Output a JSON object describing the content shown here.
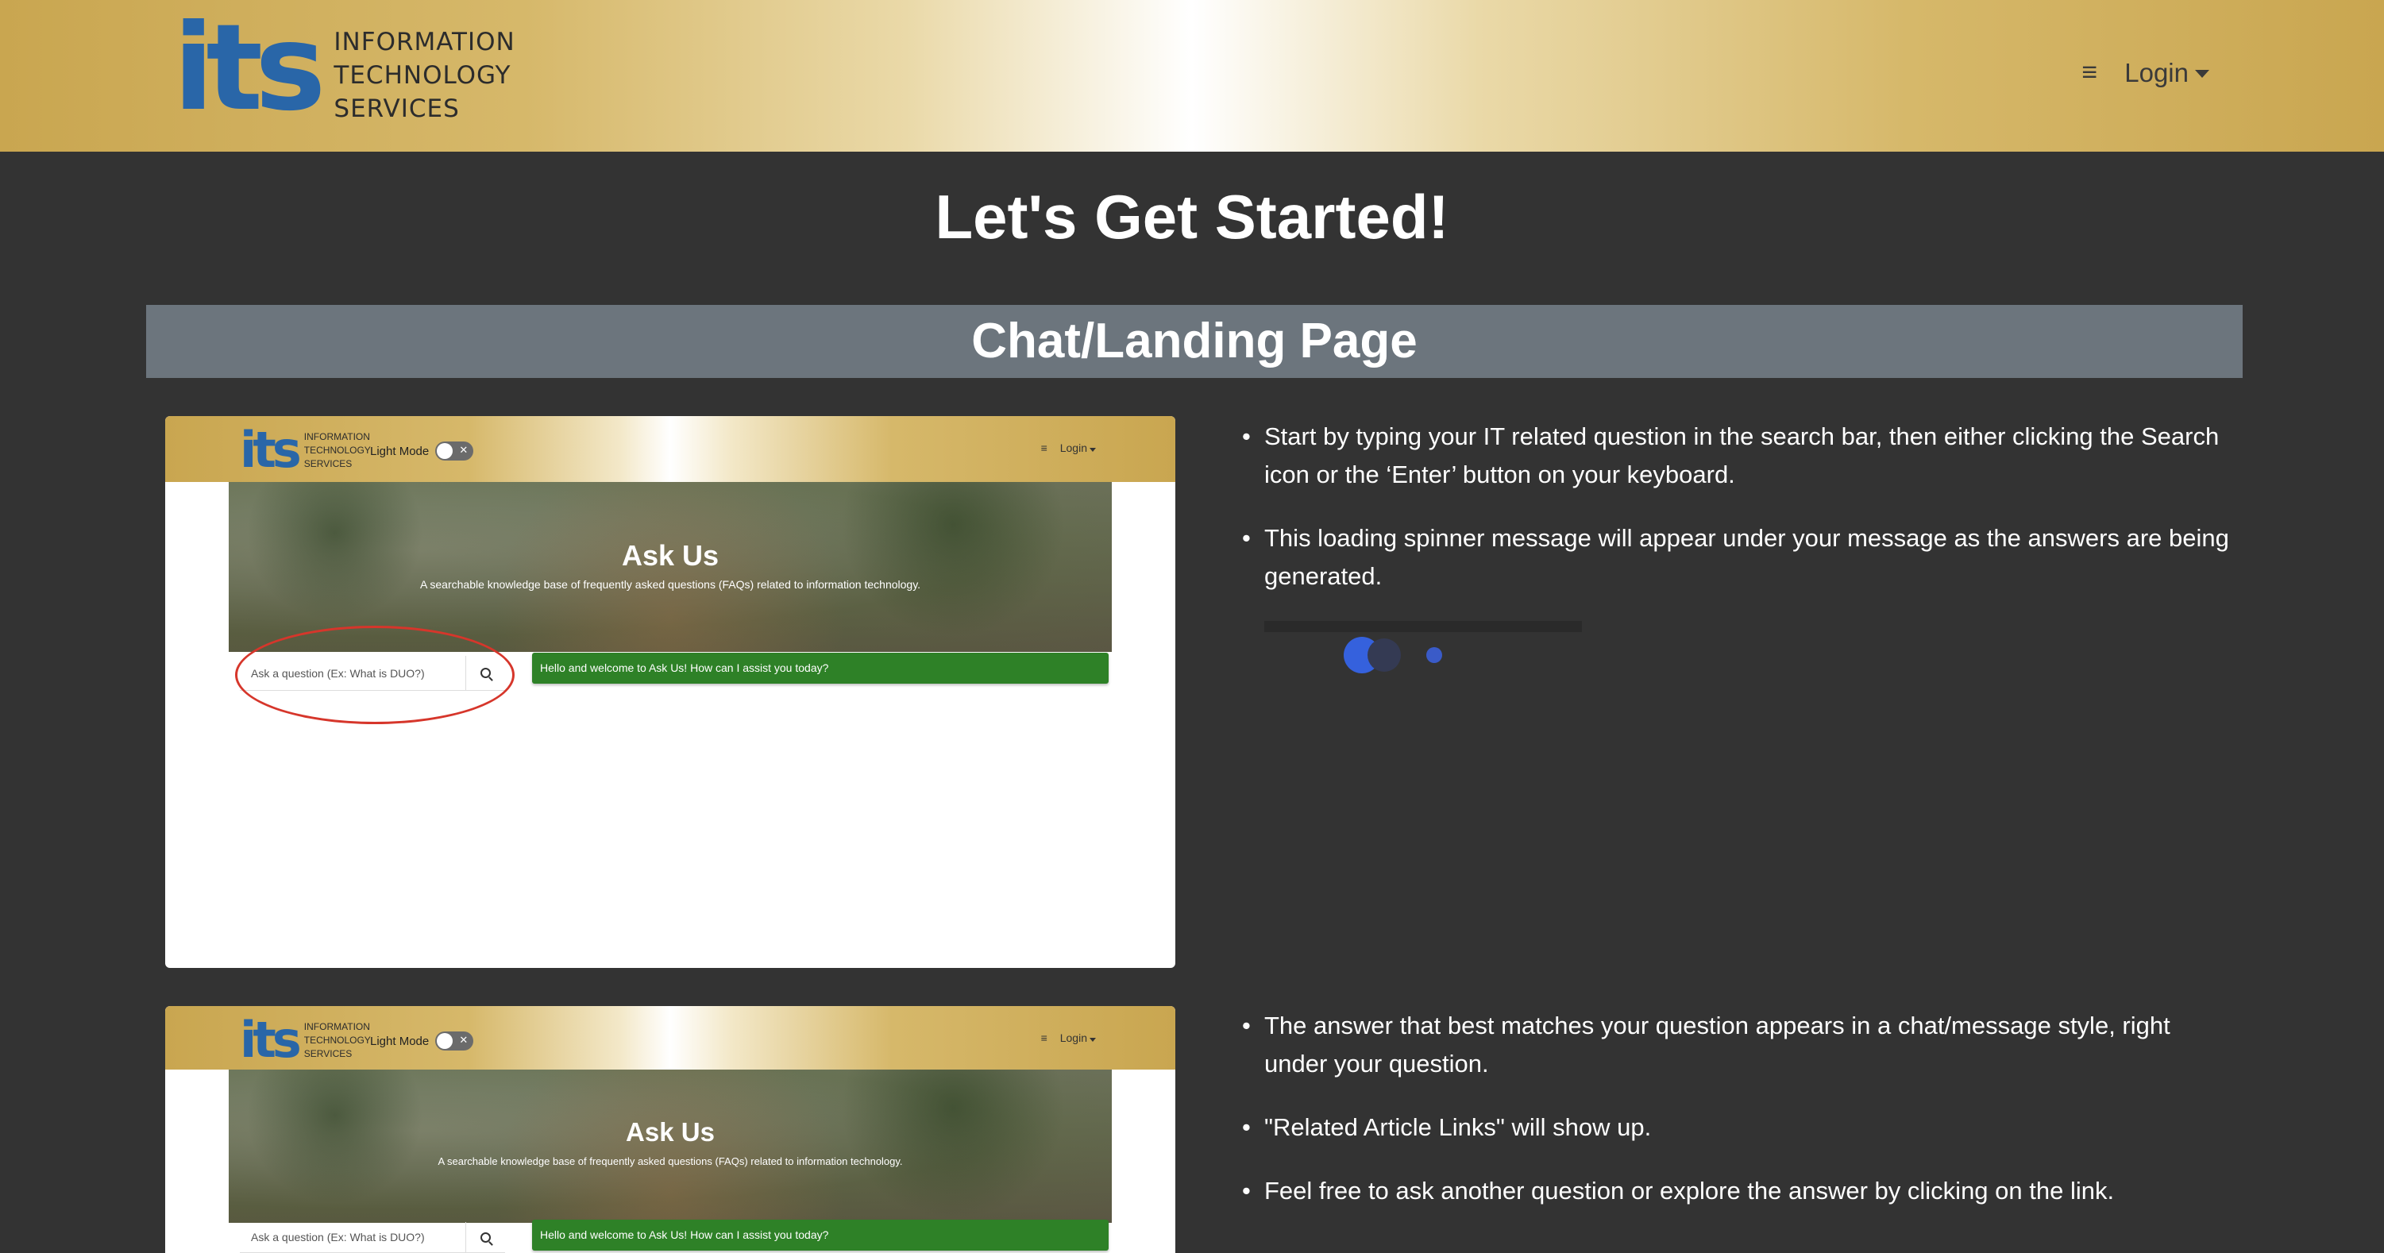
{
  "navbar": {
    "logo_mark": "its",
    "logo_lines": [
      "INFORMATION",
      "TECHNOLOGY",
      "SERVICES"
    ],
    "menu_icon": "≡",
    "login_label": "Login"
  },
  "page_title": "Let's Get Started!",
  "section_title": "Chat/Landing Page",
  "screenshot": {
    "logo_mark": "its",
    "logo_lines": [
      "INFORMATION",
      "TECHNOLOGY",
      "SERVICES"
    ],
    "mode_label": "Light Mode",
    "menu_icon": "≡",
    "login_label": "Login",
    "hero_title": "Ask Us",
    "hero_subtitle": "A searchable knowledge base of frequently asked questions (FAQs) related to information technology.",
    "search_placeholder": "Ask a question (Ex: What is DUO?)",
    "welcome_message": "Hello and welcome to Ask Us! How can I assist you today?"
  },
  "instructions_1": [
    "Start by typing your IT related question in the search bar, then either clicking the Search icon or the ‘Enter’ button on your keyboard.",
    "This loading spinner message will appear under your message as the answers are being generated."
  ],
  "instructions_2": [
    "The answer that best matches your question appears in a chat/message style, right under your question.",
    "\"Related Article Links\" will show up.",
    "Feel free to ask another question or explore the answer by clicking on the link."
  ],
  "colors": {
    "accent_gold": "#c9a650",
    "brand_blue": "#2966a8",
    "section_gray": "#6c757d",
    "chat_green": "#2e8127",
    "highlight_red": "#d6362b",
    "spinner_blue": "#3561dd"
  }
}
